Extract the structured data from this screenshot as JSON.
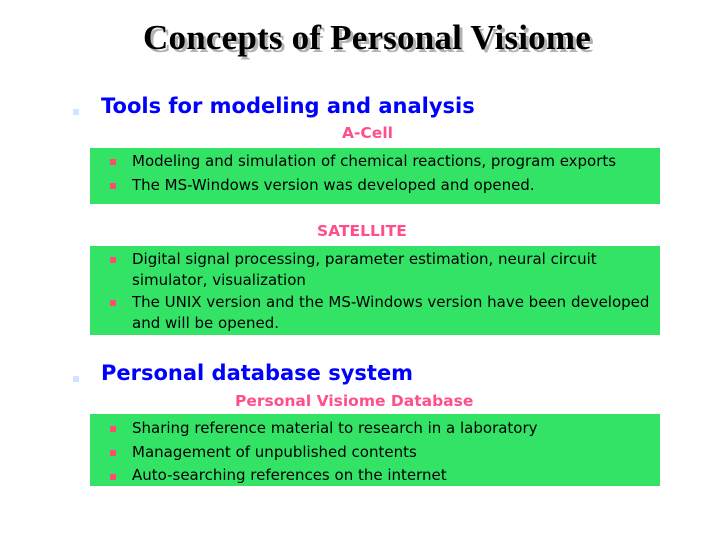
{
  "title": "Concepts of Personal Visiome",
  "sections": [
    {
      "heading": "Tools for modeling and analysis",
      "groups": [
        {
          "label": "A-Cell",
          "items": [
            "Modeling and simulation of chemical reactions, program exports",
            "The MS-Windows version was developed and opened."
          ]
        },
        {
          "label": "SATELLITE",
          "items": [
            "Digital signal processing, parameter estimation, neural circuit simulator, visualization",
            "The UNIX version and the MS-Windows version have been developed and will be opened."
          ]
        }
      ]
    },
    {
      "heading": "Personal database system",
      "groups": [
        {
          "label": "Personal Visiome Database",
          "items": [
            "Sharing reference material to research in a laboratory",
            "Management of unpublished contents",
            "Auto-searching references on the internet"
          ]
        }
      ]
    }
  ],
  "colors": {
    "heading": "#0000ff",
    "subtitle": "#ff4f8b",
    "box": "#33e366",
    "bullet_main": "#cfe4ff",
    "bullet_sub": "#ff4d6d"
  }
}
